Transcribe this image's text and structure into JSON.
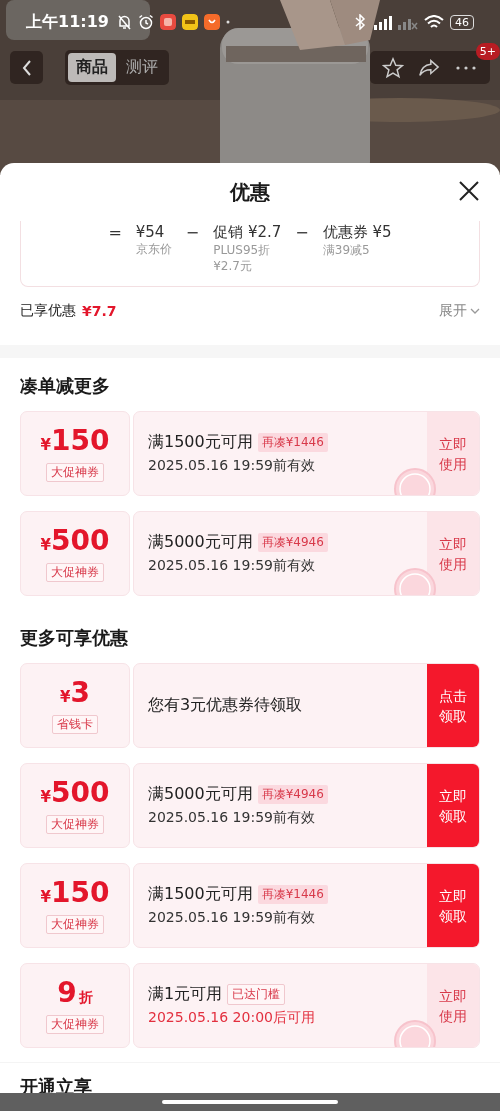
{
  "status_bar": {
    "time": "上午11:19",
    "battery": "46"
  },
  "nav": {
    "tabs": [
      {
        "label": "商品",
        "selected": true
      },
      {
        "label": "测评",
        "selected": false
      }
    ],
    "badge": "5+"
  },
  "sheet": {
    "title": "优惠",
    "breakdown": [
      {
        "op": "=",
        "amount": "¥54",
        "notes": [
          "京东价"
        ]
      },
      {
        "op": "−",
        "amount": "促销 ¥2.7",
        "notes": [
          "PLUS95折",
          "¥2.7元"
        ]
      },
      {
        "op": "−",
        "amount": "优惠券 ¥5",
        "notes": [
          "满39减5"
        ]
      }
    ],
    "summary": {
      "label": "已享优惠",
      "value": "¥7.7",
      "toggle": "展开"
    },
    "sections": [
      {
        "title": "凑单减更多",
        "coupons": [
          {
            "kind": "amount",
            "currency": "¥",
            "value": "150",
            "type": "大促神券",
            "title": "满1500元可用",
            "tag": "再凑¥1446",
            "tag_reached": false,
            "date": "2025.05.16 19:59前有效",
            "date_pending": false,
            "action": "立即使用",
            "action_highlighted": false,
            "claimed": true
          },
          {
            "kind": "amount",
            "currency": "¥",
            "value": "500",
            "type": "大促神券",
            "title": "满5000元可用",
            "tag": "再凑¥4946",
            "tag_reached": false,
            "date": "2025.05.16 19:59前有效",
            "date_pending": false,
            "action": "立即使用",
            "action_highlighted": false,
            "claimed": true
          }
        ]
      },
      {
        "title": "更多可享优惠",
        "coupons": [
          {
            "kind": "amount",
            "currency": "¥",
            "value": "3",
            "type": "省钱卡",
            "title": "您有3元优惠券待领取",
            "action": "点击领取",
            "action_highlighted": true,
            "claimed": false
          },
          {
            "kind": "amount",
            "currency": "¥",
            "value": "500",
            "type": "大促神券",
            "title": "满5000元可用",
            "tag": "再凑¥4946",
            "tag_reached": false,
            "date": "2025.05.16 19:59前有效",
            "date_pending": false,
            "action": "立即领取",
            "action_highlighted": true,
            "claimed": false
          },
          {
            "kind": "amount",
            "currency": "¥",
            "value": "150",
            "type": "大促神券",
            "title": "满1500元可用",
            "tag": "再凑¥1446",
            "tag_reached": false,
            "date": "2025.05.16 19:59前有效",
            "date_pending": false,
            "action": "立即领取",
            "action_highlighted": true,
            "claimed": false
          },
          {
            "kind": "discount",
            "value": "9",
            "unit": "折",
            "type": "大促神券",
            "title": "满1元可用",
            "tag": "已达门槛",
            "tag_reached": true,
            "date": "2025.05.16 20:00后可用",
            "date_pending": true,
            "action": "立即使用",
            "action_highlighted": false,
            "claimed": true
          }
        ]
      }
    ],
    "footer_section": {
      "title": "开通立享"
    }
  }
}
